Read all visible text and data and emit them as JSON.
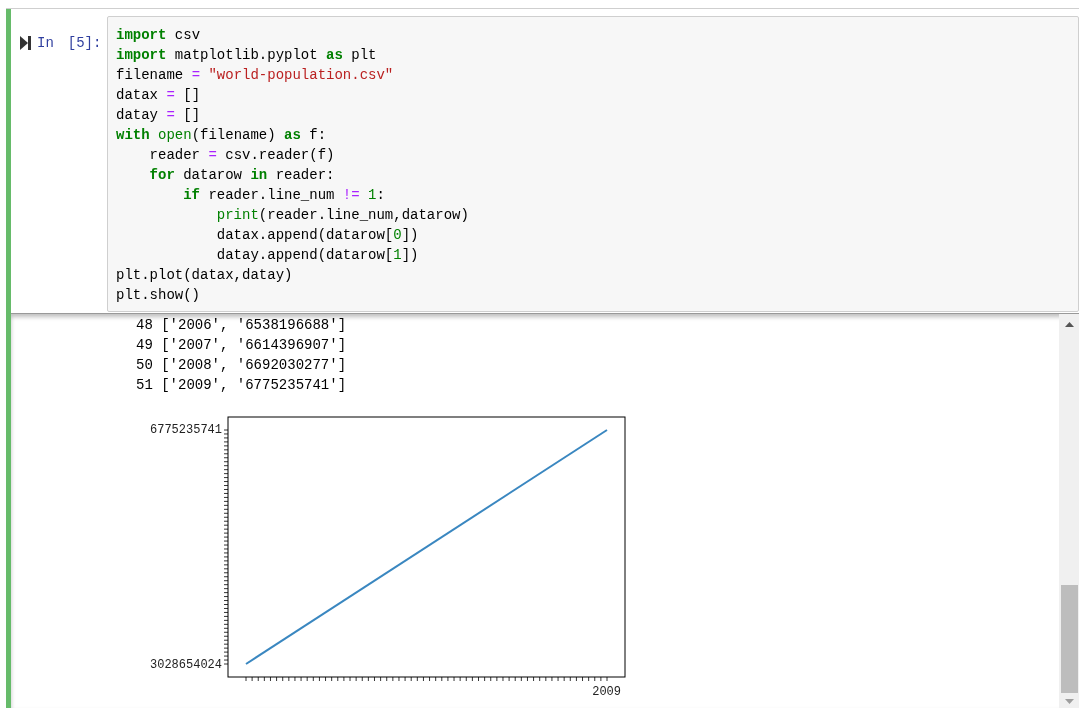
{
  "cell": {
    "prompt": "In",
    "count": "[5]:",
    "code_lines": [
      {
        "tokens": [
          {
            "kind": "keyword",
            "text": "import"
          },
          {
            "kind": "plain",
            "text": " csv"
          }
        ]
      },
      {
        "tokens": [
          {
            "kind": "keyword",
            "text": "import"
          },
          {
            "kind": "plain",
            "text": " matplotlib.pyplot "
          },
          {
            "kind": "keyword",
            "text": "as"
          },
          {
            "kind": "plain",
            "text": " plt"
          }
        ]
      },
      {
        "tokens": [
          {
            "kind": "plain",
            "text": "filename "
          },
          {
            "kind": "operator",
            "text": "="
          },
          {
            "kind": "string",
            "text": " \"world-population.csv\""
          }
        ]
      },
      {
        "tokens": [
          {
            "kind": "plain",
            "text": "datax "
          },
          {
            "kind": "operator",
            "text": "="
          },
          {
            "kind": "plain",
            "text": " []"
          }
        ]
      },
      {
        "tokens": [
          {
            "kind": "plain",
            "text": "datay "
          },
          {
            "kind": "operator",
            "text": "="
          },
          {
            "kind": "plain",
            "text": " []"
          }
        ]
      },
      {
        "tokens": [
          {
            "kind": "keyword",
            "text": "with"
          },
          {
            "kind": "builtin",
            "text": " open"
          },
          {
            "kind": "plain",
            "text": "(filename) "
          },
          {
            "kind": "keyword",
            "text": "as"
          },
          {
            "kind": "plain",
            "text": " f:"
          }
        ]
      },
      {
        "tokens": [
          {
            "kind": "plain",
            "text": "    reader "
          },
          {
            "kind": "operator",
            "text": "="
          },
          {
            "kind": "plain",
            "text": " csv.reader(f)"
          }
        ]
      },
      {
        "tokens": [
          {
            "kind": "keyword",
            "text": "    for"
          },
          {
            "kind": "plain",
            "text": " datarow "
          },
          {
            "kind": "keyword",
            "text": "in"
          },
          {
            "kind": "plain",
            "text": " reader:"
          }
        ]
      },
      {
        "tokens": [
          {
            "kind": "keyword",
            "text": "        if"
          },
          {
            "kind": "plain",
            "text": " reader.line_num "
          },
          {
            "kind": "operator",
            "text": "!="
          },
          {
            "kind": "number",
            "text": " 1"
          },
          {
            "kind": "plain",
            "text": ":"
          }
        ]
      },
      {
        "tokens": [
          {
            "kind": "builtin",
            "text": "            print"
          },
          {
            "kind": "plain",
            "text": "(reader.line_num,datarow)"
          }
        ]
      },
      {
        "tokens": [
          {
            "kind": "plain",
            "text": "            datax.append(datarow["
          },
          {
            "kind": "number",
            "text": "0"
          },
          {
            "kind": "plain",
            "text": "])"
          }
        ]
      },
      {
        "tokens": [
          {
            "kind": "plain",
            "text": "            datay.append(datarow["
          },
          {
            "kind": "number",
            "text": "1"
          },
          {
            "kind": "plain",
            "text": "])"
          }
        ]
      },
      {
        "tokens": [
          {
            "kind": "plain",
            "text": "plt.plot(datax,datay)"
          }
        ]
      },
      {
        "tokens": [
          {
            "kind": "plain",
            "text": "plt.show()"
          }
        ]
      }
    ],
    "output_lines": [
      "48 ['2006', '6538196688']",
      "49 ['2007', '6614396907']",
      "50 ['2008', '6692030277']",
      "51 ['2009', '6775235741']"
    ],
    "plot": {
      "y_top_label": "6775235741",
      "y_bottom_label": "3028654024",
      "x_last_label": "2009"
    }
  }
}
